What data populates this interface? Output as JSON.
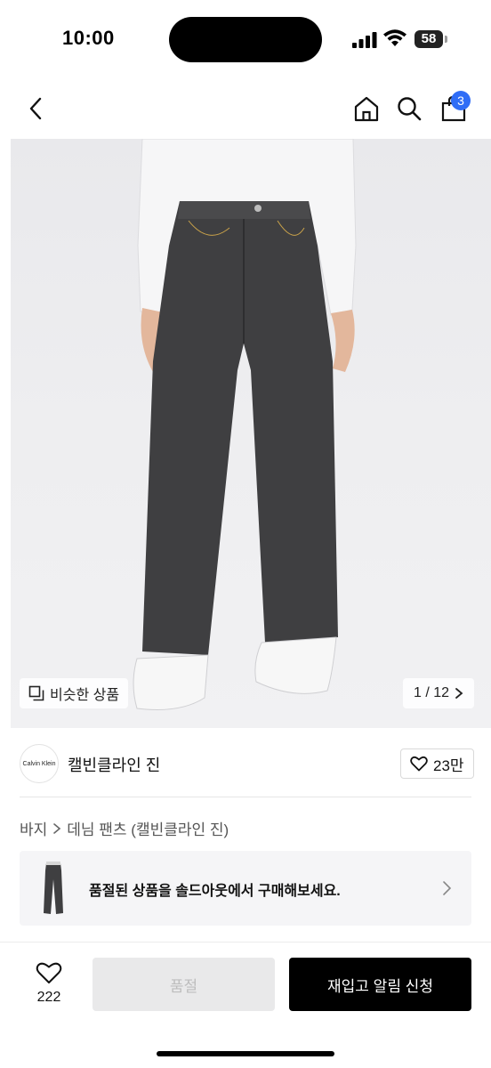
{
  "status_bar": {
    "time": "10:00",
    "battery": "58"
  },
  "nav": {
    "cart_count": "3"
  },
  "hero": {
    "similar_label": "비슷한 상품",
    "page_indicator": "1 / 12"
  },
  "brand": {
    "logo_text": "Calvin Klein",
    "name": "캘빈클라인 진",
    "likes": "23만"
  },
  "breadcrumb": {
    "items": [
      "바지",
      "데님 팬츠 (캘빈클라인 진)"
    ]
  },
  "soldout_banner": {
    "text": "품절된 상품을 솔드아웃에서 구매해보세요."
  },
  "bottom_bar": {
    "wish_count": "222",
    "soldout_label": "품절",
    "restock_label": "재입고 알림 신청"
  },
  "colors": {
    "accent_blue": "#2f6df6",
    "primary_black": "#000000",
    "disabled_gray": "#e9e9ea"
  }
}
